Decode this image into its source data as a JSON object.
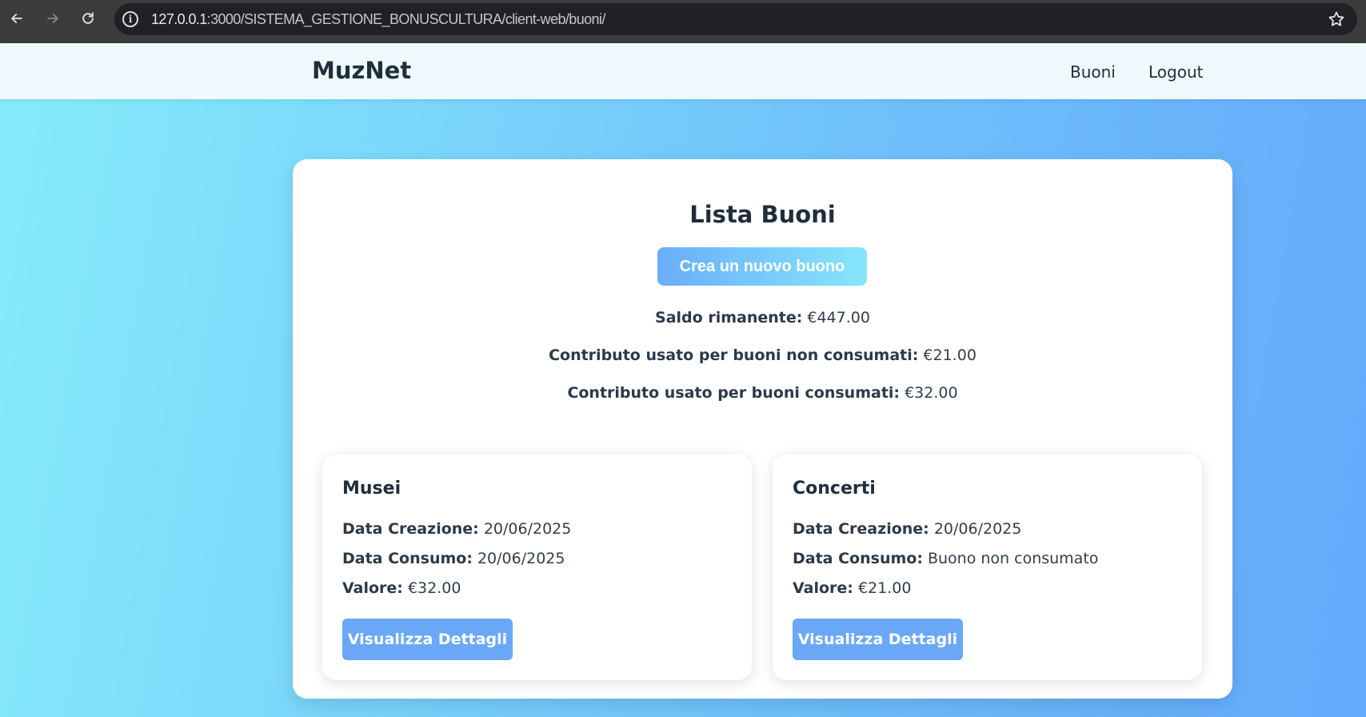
{
  "browser": {
    "url_host": "127.0.0.1",
    "url_rest": ":3000/SISTEMA_GESTIONE_BONUSCULTURA/client-web/buoni/"
  },
  "nav": {
    "brand": "MuzNet",
    "links": [
      "Buoni",
      "Logout"
    ]
  },
  "main": {
    "title": "Lista Buoni",
    "create_button": "Crea un nuovo buono",
    "stats": [
      {
        "label": "Saldo rimanente:",
        "value": "€447.00"
      },
      {
        "label": "Contributo usato per buoni non consumati:",
        "value": "€21.00"
      },
      {
        "label": "Contributo usato per buoni consumati:",
        "value": "€32.00"
      }
    ]
  },
  "vouchers": [
    {
      "title": "Musei",
      "created_label": "Data Creazione:",
      "created_value": "20/06/2025",
      "consumed_label": "Data Consumo:",
      "consumed_value": "20/06/2025",
      "value_label": "Valore:",
      "value_value": "€32.00",
      "button": "Visualizza Dettagli"
    },
    {
      "title": "Concerti",
      "created_label": "Data Creazione:",
      "created_value": "20/06/2025",
      "consumed_label": "Data Consumo:",
      "consumed_value": "Buono non consumato",
      "value_label": "Valore:",
      "value_value": "€21.00",
      "button": "Visualizza Dettagli"
    }
  ]
}
